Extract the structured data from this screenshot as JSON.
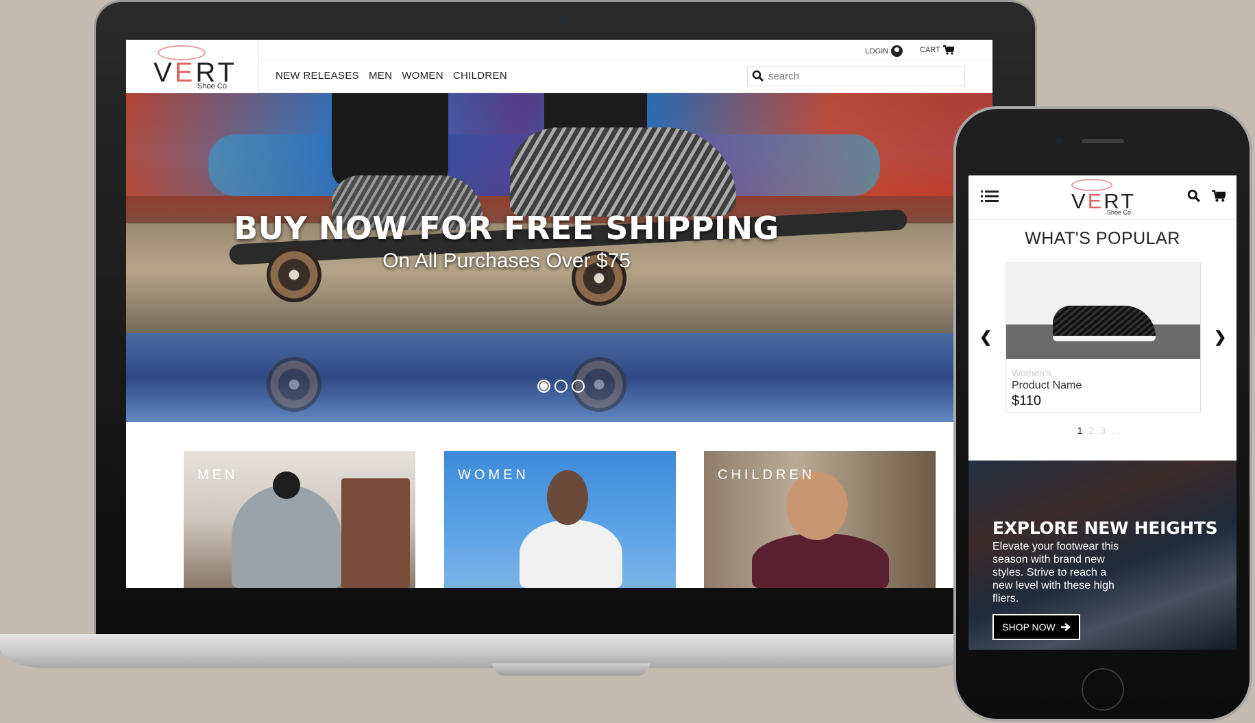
{
  "desktop": {
    "logo": {
      "letters_left": "V",
      "letter_e": "E",
      "letters_right": "RT",
      "subtitle": "Shoe Co."
    },
    "utility": {
      "login": "LOGIN",
      "cart": "CART"
    },
    "nav": [
      "NEW RELEASES",
      "MEN",
      "WOMEN",
      "CHILDREN"
    ],
    "search": {
      "placeholder": "search",
      "value": ""
    },
    "hero": {
      "title": "BUY NOW FOR FREE SHIPPING",
      "subtitle": "On All Purchases Over $75",
      "slide_count": 3,
      "active_slide": 1
    },
    "categories": [
      "MEN",
      "WOMEN",
      "CHILDREN"
    ]
  },
  "mobile": {
    "logo": {
      "letters_left": "V",
      "letter_e": "E",
      "letters_right": "RT",
      "subtitle": "Shoe Co."
    },
    "section_title": "WHAT'S POPULAR",
    "product": {
      "category": "Women's",
      "name": "Product Name",
      "price": "$110"
    },
    "pagination": {
      "current": "1",
      "others": [
        "2",
        "3"
      ]
    },
    "promo": {
      "title": "EXPLORE NEW HEIGHTS",
      "text": "Elevate your footwear this season with brand new styles. Strive to reach a new level with these high fliers.",
      "button": "SHOP NOW"
    }
  },
  "colors": {
    "background": "#c3bab0",
    "logo_accent": "#e0625f",
    "bow": "#e79a9a"
  },
  "icons": [
    "user-circle-icon",
    "cart-icon",
    "search-icon",
    "hamburger-menu-icon",
    "chevron-left-icon",
    "chevron-right-icon",
    "arrow-right-icon"
  ]
}
